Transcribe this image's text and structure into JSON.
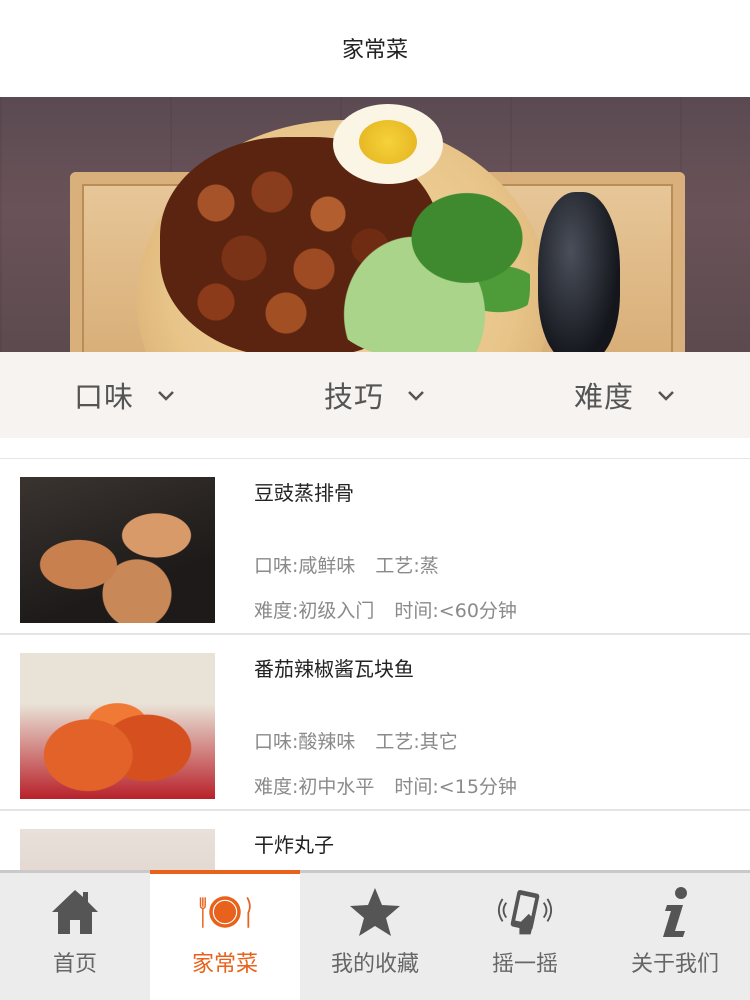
{
  "header": {
    "title": "家常菜"
  },
  "filters": [
    {
      "label": "口味"
    },
    {
      "label": "技巧"
    },
    {
      "label": "难度"
    }
  ],
  "recipes": [
    {
      "name": "豆豉蒸排骨",
      "flavor": "口味:咸鲜味",
      "craft": "工艺:蒸",
      "difficulty": "难度:初级入门",
      "time": "时间:<60分钟"
    },
    {
      "name": "番茄辣椒酱瓦块鱼",
      "flavor": "口味:酸辣味",
      "craft": "工艺:其它",
      "difficulty": "难度:初中水平",
      "time": "时间:<15分钟"
    },
    {
      "name": "干炸丸子"
    }
  ],
  "tabs": [
    {
      "label": "首页",
      "icon": "home-icon"
    },
    {
      "label": "家常菜",
      "icon": "plate-cutlery-icon"
    },
    {
      "label": "我的收藏",
      "icon": "star-icon"
    },
    {
      "label": "摇一摇",
      "icon": "shake-phone-icon"
    },
    {
      "label": "关于我们",
      "icon": "info-icon"
    }
  ],
  "colors": {
    "accent": "#e8621c",
    "tab_bar": "#ececec",
    "filter_bar": "#f7f3f1",
    "muted_text": "#8a8a8a"
  }
}
